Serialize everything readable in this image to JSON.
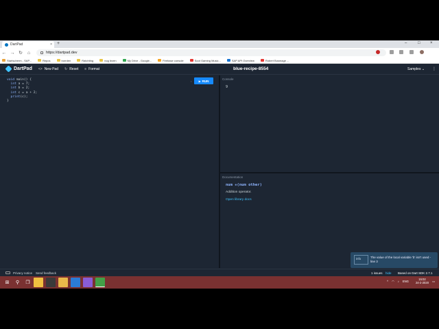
{
  "browser": {
    "tab_title": "DartPad",
    "tab_close": "×",
    "new_tab": "+",
    "url": "https://dartpad.dev",
    "window_controls": [
      "–",
      "□",
      "×"
    ],
    "nav": {
      "back": "←",
      "forward": "→",
      "reload": "↻",
      "home": "⌂"
    },
    "bookmarks": [
      {
        "label": "Startscherm - SAP...",
        "color": "#e8a33d"
      },
      {
        "label": "Repos",
        "color": "#e8c547"
      },
      {
        "label": "borrden",
        "color": "#e8c547"
      },
      {
        "label": "Ratchting",
        "color": "#e8c547"
      },
      {
        "label": "nog lezen",
        "color": "#e8c547"
      },
      {
        "label": "My Drive - Google...",
        "color": "#34a853"
      },
      {
        "label": "Firebase console",
        "color": "#f5a623"
      },
      {
        "label": "Soot Gaming Music...",
        "color": "#e53935"
      },
      {
        "label": "SAP API Overview",
        "color": "#1976d2"
      },
      {
        "label": "Robert Bosmage ...",
        "color": "#e53935"
      }
    ]
  },
  "dartpad": {
    "title": "DartPad",
    "new_pad": "New Pad",
    "reset": "Reset",
    "format": "Format",
    "pad_name": "blue-recipe-8554",
    "samples": "Samples",
    "samples_chevron": "⌄",
    "menu_kebab": "⋮",
    "run_label": "RUN",
    "run_dot": "•",
    "code_lines": [
      {
        "indent": "",
        "kw": "void",
        "rest": " main() {"
      },
      {
        "indent": "  ",
        "kw": "int",
        "rest": " a = 7;"
      },
      {
        "indent": "  ",
        "kw": "int",
        "rest": " b = 2;"
      },
      {
        "indent": "  ",
        "kw": "int",
        "rest": " c = a + 2;"
      },
      {
        "indent": "  ",
        "kw": "print",
        "rest": "(c);"
      },
      {
        "indent": "",
        "kw": "",
        "rest": "}"
      }
    ],
    "console_label": "Console",
    "console_output": "9",
    "docs_label": "Documentation",
    "doc_signature": "num +(num other)",
    "doc_description": "Addition operator.",
    "doc_link": "Open library docs",
    "toast_level": "info",
    "toast_message": "The value of the local variable 'b' isn't used - line 3",
    "footer_privacy": "Privacy notice",
    "footer_feedback": "Send feedback",
    "issues": "1 issues",
    "hide": "hide",
    "sdk": "Based on Dart SDK 2.7.1"
  },
  "taskbar": {
    "start": "⊞",
    "search": "⚲",
    "taskview": "❐",
    "apps": [
      {
        "name": "explorer-app",
        "color": "#f0c040"
      },
      {
        "name": "mail-app",
        "color": "#3a3a3a"
      },
      {
        "name": "files-app",
        "color": "#e8b84a"
      },
      {
        "name": "vscode-app",
        "color": "#2b7bd6"
      },
      {
        "name": "visualstudio-app",
        "color": "#8a5cd6"
      },
      {
        "name": "chrome-app",
        "color": "#43a047"
      }
    ],
    "tray_arrow": "^",
    "tray_lang": "ENG",
    "time": "15:02",
    "date": "24-2-2020"
  }
}
